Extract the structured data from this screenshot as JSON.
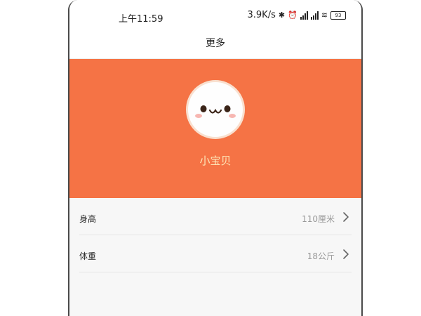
{
  "status_bar": {
    "time": "上午11:59",
    "net_speed": "3.9K/s",
    "battery": "93"
  },
  "icons": {
    "bluetooth": "bluetooth-icon",
    "alarm": "alarm-icon",
    "signal": "signal-icon",
    "wifi": "wifi-icon",
    "battery": "battery-icon",
    "chevron": "chevron-right-icon"
  },
  "nav": {
    "title": "更多"
  },
  "profile": {
    "name": "小宝贝"
  },
  "settings": {
    "items": [
      {
        "label": "身高",
        "value": "110厘米"
      },
      {
        "label": "体重",
        "value": "18公斤"
      }
    ]
  },
  "colors": {
    "accent": "#f57345",
    "name_text": "#fde6b8"
  }
}
